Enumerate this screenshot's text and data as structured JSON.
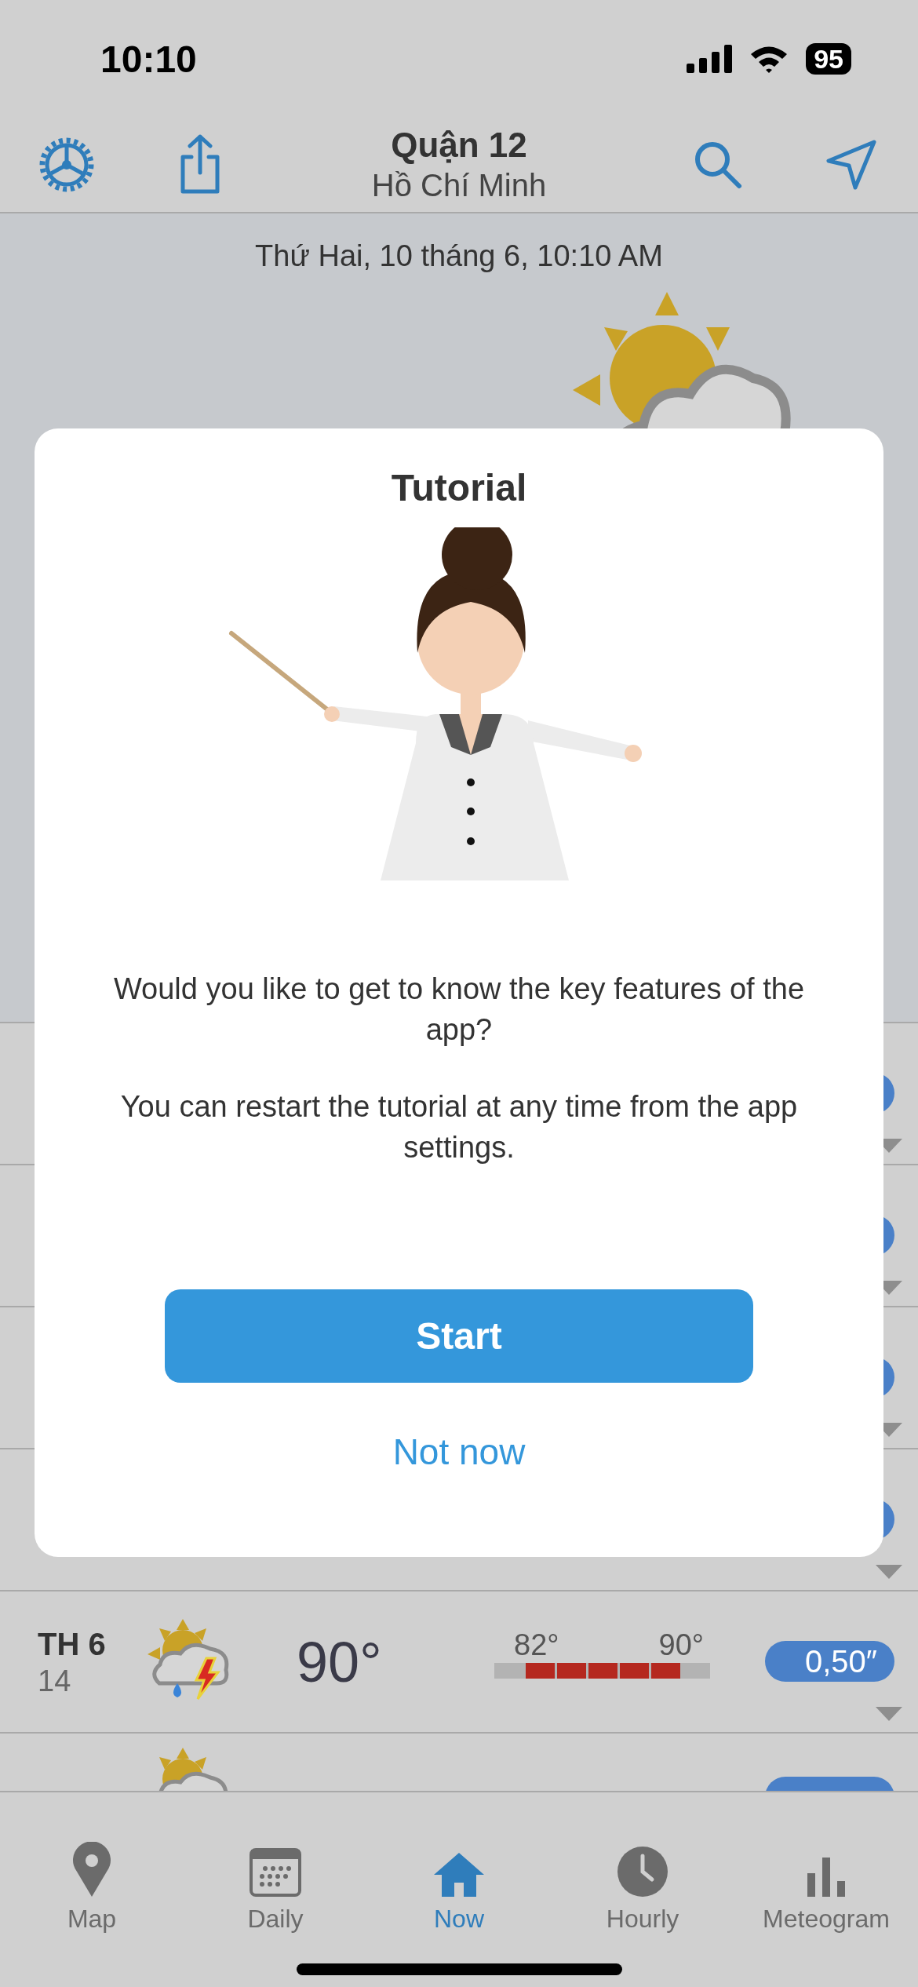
{
  "status_bar": {
    "time": "10:10",
    "battery": "95"
  },
  "header": {
    "title": "Quận 12",
    "subtitle": "Hồ Chí Minh"
  },
  "current": {
    "date": "Thứ Hai, 10 tháng 6, 10:10 AM"
  },
  "forecast": [
    {
      "kind": "covered"
    },
    {
      "kind": "covered"
    },
    {
      "kind": "covered"
    },
    {
      "kind": "covered"
    },
    {
      "kind": "day",
      "day": "TH 6",
      "date": "14",
      "temperature": "90°",
      "low": "82°",
      "high": "90°",
      "precipitation": "0,50″"
    },
    {
      "kind": "partial"
    }
  ],
  "dialog": {
    "title": "Tutorial",
    "paragraphs": [
      "Would you like to get to know the key features of the app?",
      "You can restart the tutorial at any time from the app settings."
    ],
    "primary_button": "Start",
    "secondary_button": "Not now"
  },
  "tabs": [
    {
      "kind": "map",
      "label": "Map",
      "selected": false
    },
    {
      "kind": "daily",
      "label": "Daily",
      "selected": false
    },
    {
      "kind": "now",
      "label": "Now",
      "selected": true
    },
    {
      "kind": "hourly",
      "label": "Hourly",
      "selected": false
    },
    {
      "kind": "meteogram",
      "label": "Meteogram",
      "selected": false
    }
  ]
}
